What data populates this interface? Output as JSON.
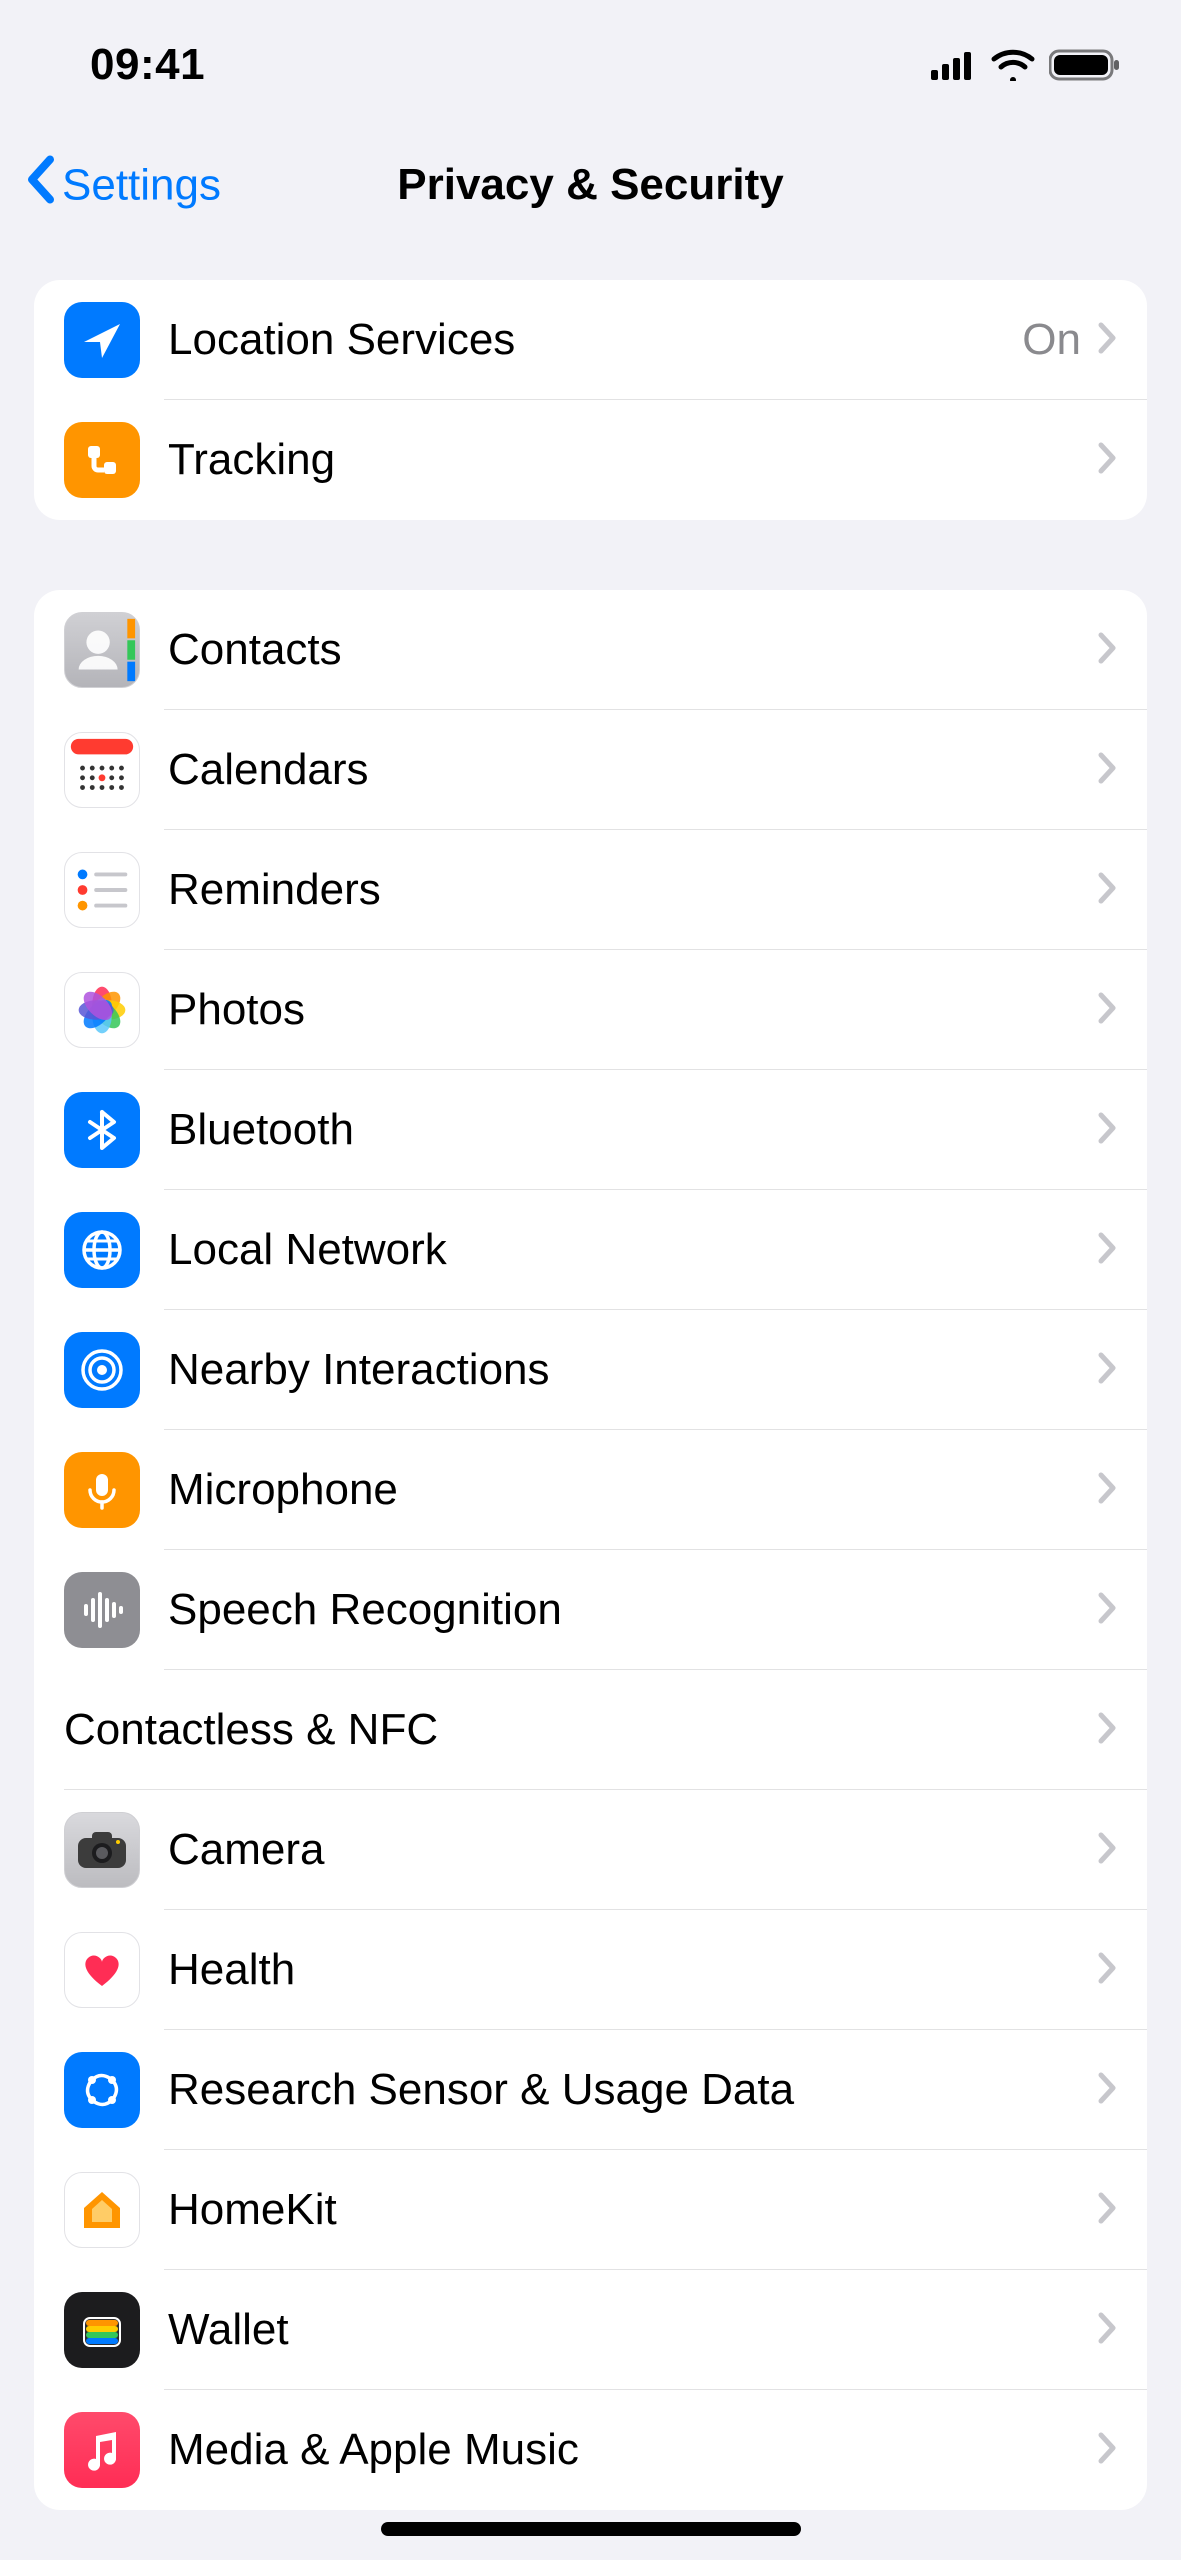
{
  "status": {
    "time": "09:41"
  },
  "nav": {
    "back": "Settings",
    "title": "Privacy & Security"
  },
  "group1": {
    "location": {
      "label": "Location Services",
      "value": "On"
    },
    "tracking": {
      "label": "Tracking"
    }
  },
  "group2": {
    "contacts": "Contacts",
    "calendars": "Calendars",
    "reminders": "Reminders",
    "photos": "Photos",
    "bluetooth": "Bluetooth",
    "localnetwork": "Local Network",
    "nearby": "Nearby Interactions",
    "microphone": "Microphone",
    "speech": "Speech Recognition",
    "contactless": "Contactless & NFC",
    "camera": "Camera",
    "health": "Health",
    "research": "Research Sensor & Usage Data",
    "homekit": "HomeKit",
    "wallet": "Wallet",
    "media": "Media & Apple Music"
  }
}
